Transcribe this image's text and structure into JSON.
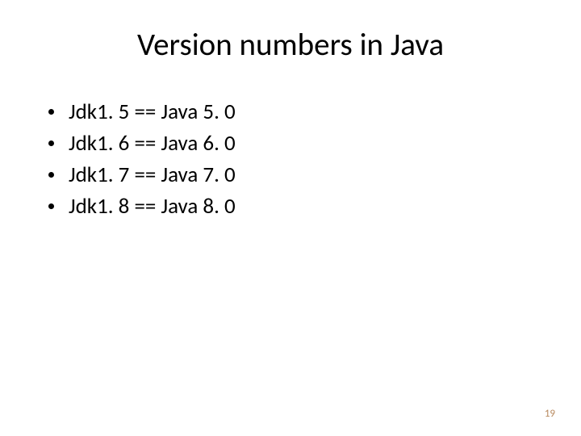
{
  "slide": {
    "title": "Version numbers in Java",
    "bullets": [
      "Jdk1. 5 == Java 5. 0",
      "Jdk1. 6 == Java 6. 0",
      "Jdk1. 7 == Java 7. 0",
      "Jdk1. 8 == Java 8. 0"
    ],
    "page_number": "19"
  }
}
